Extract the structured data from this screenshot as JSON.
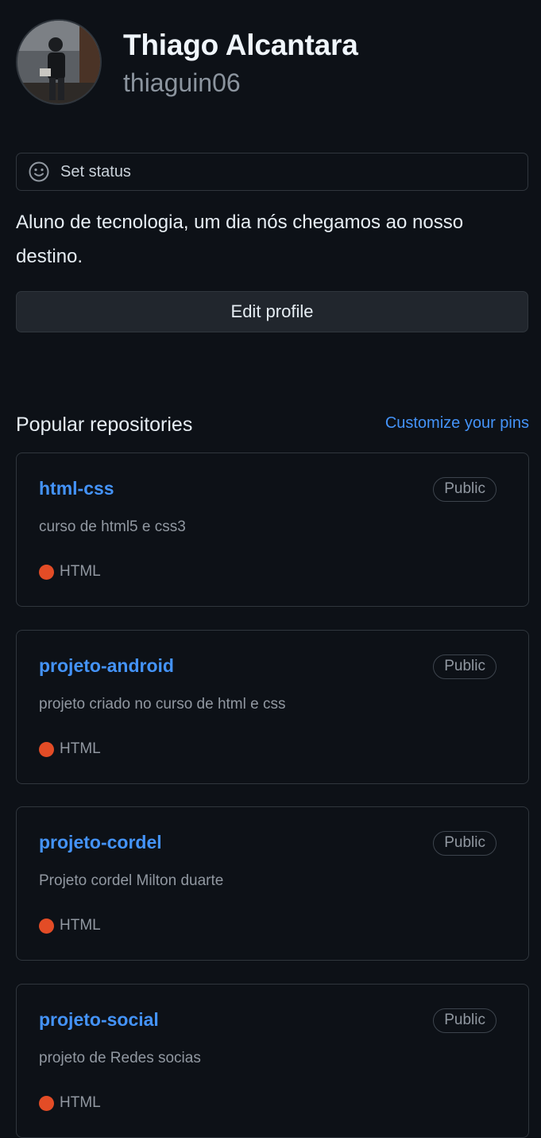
{
  "profile": {
    "name": "Thiago Alcantara",
    "username": "thiaguin06",
    "bio": "Aluno de tecnologia, um dia nós chegamos ao nosso destino."
  },
  "status": {
    "label": "Set status",
    "icon": "smiley-icon"
  },
  "actions": {
    "edit_profile": "Edit profile"
  },
  "popular": {
    "title": "Popular repositories",
    "customize_label": "Customize your pins"
  },
  "repos": [
    {
      "name": "html-css",
      "visibility": "Public",
      "description": "curso de html5 e css3",
      "language": "HTML",
      "language_color": "#e34c26"
    },
    {
      "name": "projeto-android",
      "visibility": "Public",
      "description": "projeto criado no curso de html e css",
      "language": "HTML",
      "language_color": "#e34c26"
    },
    {
      "name": "projeto-cordel",
      "visibility": "Public",
      "description": "Projeto cordel Milton duarte",
      "language": "HTML",
      "language_color": "#e34c26"
    },
    {
      "name": "projeto-social",
      "visibility": "Public",
      "description": "projeto de Redes socias",
      "language": "HTML",
      "language_color": "#e34c26"
    }
  ],
  "colors": {
    "background": "#0d1117",
    "link": "#4493f8",
    "border": "#30363d",
    "muted": "#9198a1"
  }
}
